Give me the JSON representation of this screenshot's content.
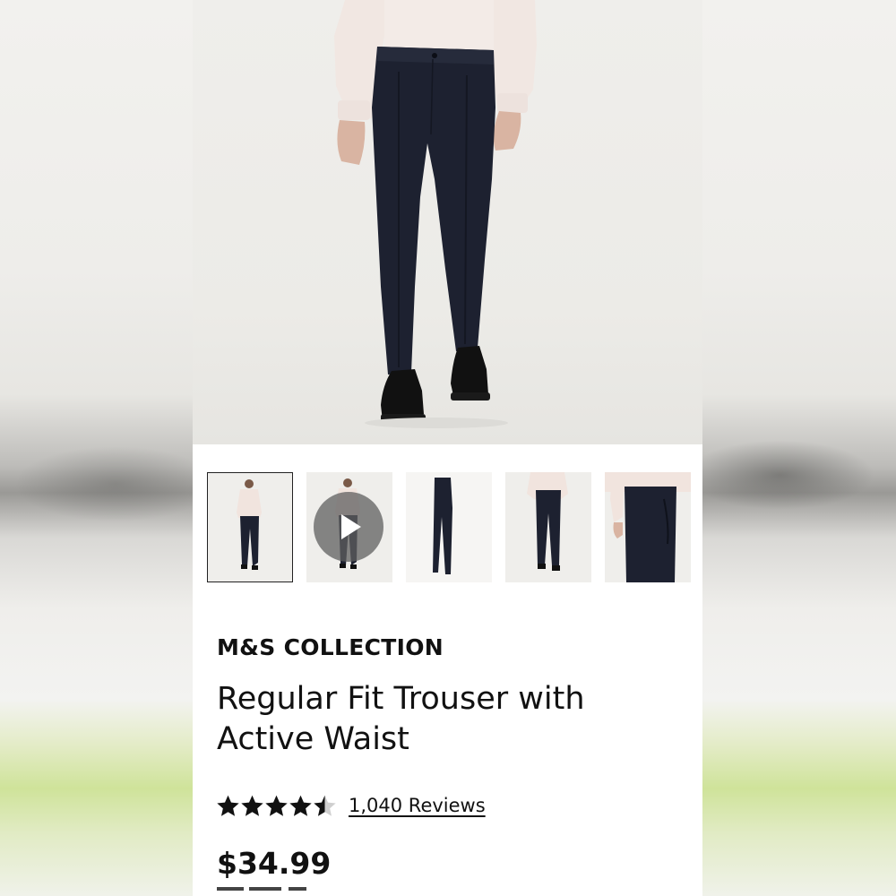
{
  "product": {
    "brand": "M&S COLLECTION",
    "title": "Regular Fit Trouser with Active Waist",
    "rating": 4.5,
    "rating_max": 5,
    "reviews_label": "1,040 Reviews",
    "price": "$34.99"
  },
  "gallery": {
    "thumbnails": [
      {
        "type": "image",
        "selected": true,
        "icon": "model-full-front"
      },
      {
        "type": "video",
        "selected": false,
        "icon": "play-icon"
      },
      {
        "type": "image",
        "selected": false,
        "icon": "trouser-flat"
      },
      {
        "type": "image",
        "selected": false,
        "icon": "model-lower-body"
      },
      {
        "type": "image",
        "selected": false,
        "icon": "model-pocket-detail"
      }
    ]
  },
  "colors": {
    "trouser": "#1d2130",
    "shirt": "#f1e7e2",
    "text": "#111111",
    "background": "#ffffff"
  }
}
